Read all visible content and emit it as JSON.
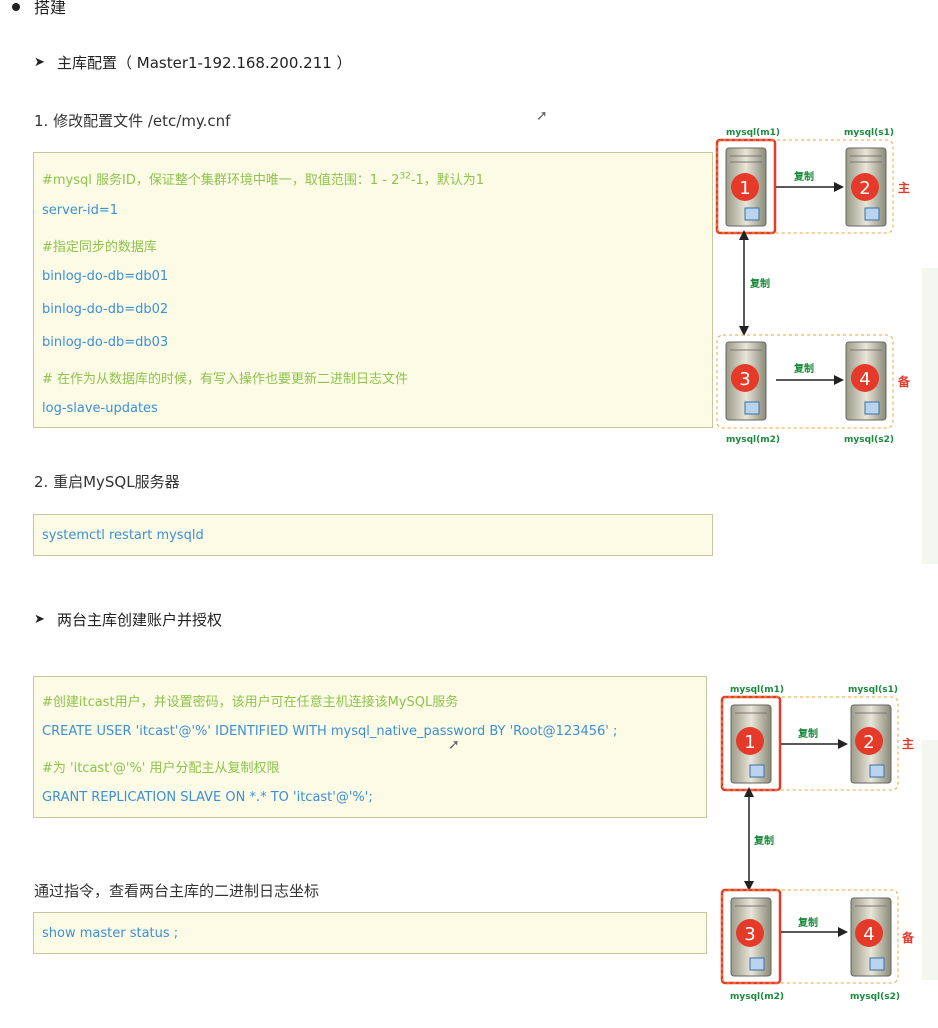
{
  "heading_cut": "搭建",
  "section1": {
    "arrow": "➤",
    "title": "主库配置（ Master1-192.168.200.211 ）"
  },
  "step1": {
    "title": "1. 修改配置文件 /etc/my.cnf",
    "lines": [
      {
        "text": "#mysql 服务ID，保证整个集群环境中唯一，取值范围：1 - 2",
        "sup": "32",
        "tail": "-1，默认为1",
        "kind": "comment"
      },
      {
        "text": "server-id=1",
        "kind": "code"
      },
      {
        "text": "#指定同步的数据库",
        "kind": "comment"
      },
      {
        "text": "binlog-do-db=db01",
        "kind": "code"
      },
      {
        "text": "binlog-do-db=db02",
        "kind": "code"
      },
      {
        "text": "binlog-do-db=db03",
        "kind": "code"
      },
      {
        "text": "# 在作为从数据库的时候，有写入操作也要更新二进制日志文件",
        "kind": "comment"
      },
      {
        "text": "log-slave-updates",
        "kind": "code"
      }
    ]
  },
  "step2": {
    "title": "2. 重启MySQL服务器",
    "command": "systemctl restart mysqld"
  },
  "section2": {
    "arrow": "➤",
    "title": "两台主库创建账户并授权"
  },
  "grant_box": {
    "lines": [
      {
        "text": "#创建itcast用户，并设置密码，该用户可在任意主机连接该MySQL服务",
        "kind": "comment"
      },
      {
        "text": "CREATE USER 'itcast'@'%' IDENTIFIED WITH mysql_native_password BY 'Root@123456' ;",
        "kind": "code"
      },
      {
        "text": "#为 'itcast'@'%' 用户分配主从复制权限",
        "kind": "comment"
      },
      {
        "text": "GRANT REPLICATION SLAVE ON *.* TO 'itcast'@'%';",
        "kind": "code"
      }
    ]
  },
  "status_hint": "通过指令，查看两台主库的二进制日志坐标",
  "status_command": "show master status ;",
  "diagram": {
    "label_m1": "mysql(m1)",
    "label_s1": "mysql(s1)",
    "label_m2": "mysql(m2)",
    "label_s2": "mysql(s2)",
    "replicate": "复制",
    "primary": "主",
    "backup": "备",
    "n1": "1",
    "n2": "2",
    "n3": "3",
    "n4": "4",
    "accent_red": "#e53a2a",
    "accent_green": "#1a8a3c",
    "accent_orange": "#f0a030"
  }
}
